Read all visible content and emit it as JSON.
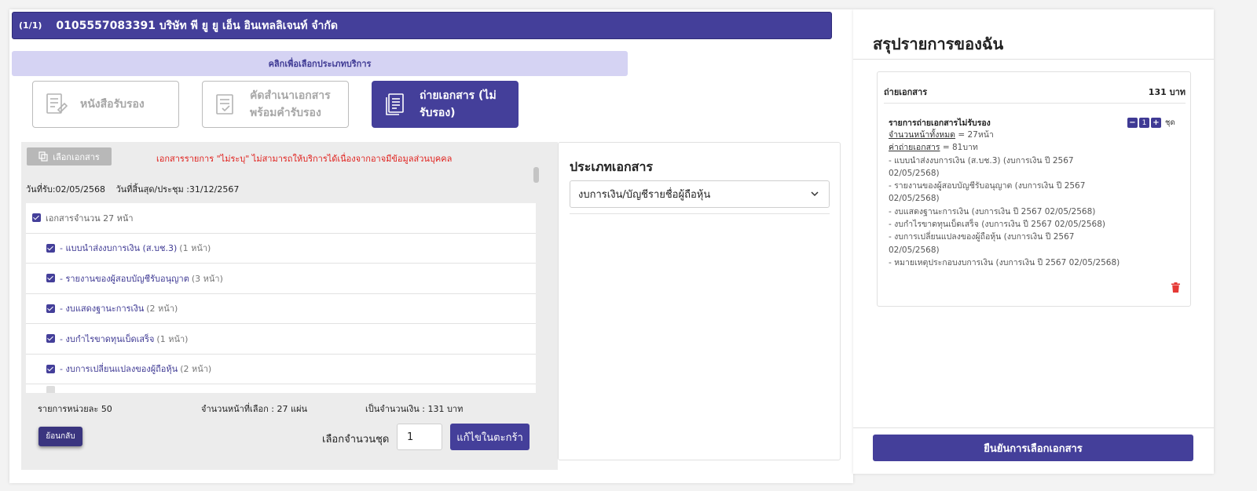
{
  "header": {
    "count": "(1/1)",
    "company": "0105557083391 บริษัท พี ยู ยู เอ็น อินเทลลิเจนท์ จำกัด"
  },
  "hint": "คลิกเพื่อเลือกประเภทบริการ",
  "services": [
    {
      "label": "หนังสือรับรอง",
      "icon": "certificate-icon",
      "active": false
    },
    {
      "label": "คัดสำเนาเอกสาร\nพร้อมคำรับรอง",
      "icon": "certified-copy-icon",
      "active": false
    },
    {
      "label": "ถ่ายเอกสาร (ไม่\nรับรอง)",
      "icon": "copy-document-icon",
      "active": true
    }
  ],
  "doc_panel": {
    "select_button": "เลือกเอกสาร",
    "warning": "เอกสารรายการ \"ไม่ระบุ\" ไม่สามารถให้บริการได้เนื่องจากอาจมีข้อมูลส่วนบุคคล",
    "received_date": "วันที่รับ:02/05/2568",
    "end_date": "วันที่สิ้นสุด/ประชุม :31/12/2567",
    "total_label": "เอกสารจำนวน 27 หน้า",
    "items": [
      {
        "label": "- แบบนำส่งงบการเงิน (ส.บช.3)",
        "pages": "(1 หน้า)"
      },
      {
        "label": "- รายงานของผู้สอบบัญชีรับอนุญาต",
        "pages": "(3 หน้า)"
      },
      {
        "label": "- งบแสดงฐานะการเงิน",
        "pages": "(2 หน้า)"
      },
      {
        "label": "- งบกำไรขาดทุนเบ็ดเสร็จ",
        "pages": "(1 หน้า)"
      },
      {
        "label": "- งบการเปลี่ยนแปลงของผู้ถือหุ้น",
        "pages": "(2 หน้า)"
      }
    ]
  },
  "footer": {
    "unit_price": "รายการหน่วยละ 50",
    "pages_selected": "จำนวนหน้าที่เลือก : 27 แผ่น",
    "amount": "เป็นจำนวนเงิน : 131 บาท",
    "back": "ย้อนกลับ",
    "sets_label": "เลือกจำนวนชุด",
    "sets_value": "1",
    "edit_cart": "แก้ไขในตะกร้า"
  },
  "doc_type": {
    "title": "ประเภทเอกสาร",
    "selected": "งบการเงิน/บัญชีรายชื่อผู้ถือหุ้น"
  },
  "summary": {
    "title": "สรุปรายการของฉัน",
    "section": "ถ่ายเอกสาร",
    "section_price": "131 บาท",
    "item_title": "รายการถ่ายเอกสารไม่รับรอง",
    "qty": "1",
    "qty_unit": "ชุด",
    "total_pages_label": "จำนวนหน้าทั้งหมด",
    "total_pages_value": " = 27หน้า",
    "fee_label": "ค่าถ่ายเอกสาร",
    "fee_value": " = 81บาท",
    "lines": [
      "- แบบนำส่งงบการเงิน (ส.บช.3) (งบการเงิน ปี 2567",
      "02/05/2568)",
      "- รายงานของผู้สอบบัญชีรับอนุญาต (งบการเงิน ปี 2567",
      "02/05/2568)",
      "- งบแสดงฐานะการเงิน (งบการเงิน ปี 2567 02/05/2568)",
      "- งบกำไรขาดทุนเบ็ดเสร็จ (งบการเงิน ปี 2567 02/05/2568)",
      "- งบการเปลี่ยนแปลงของผู้ถือหุ้น (งบการเงิน ปี 2567",
      "02/05/2568)",
      "- หมายเหตุประกอบงบการเงิน (งบการเงิน ปี 2567 02/05/2568)"
    ],
    "confirm": "ยืนยันการเลือกเอกสาร"
  },
  "colors": {
    "primary": "#443f9a",
    "hint_bg": "#d5d3f3",
    "warning": "#e0211d",
    "trash": "#e53935"
  }
}
